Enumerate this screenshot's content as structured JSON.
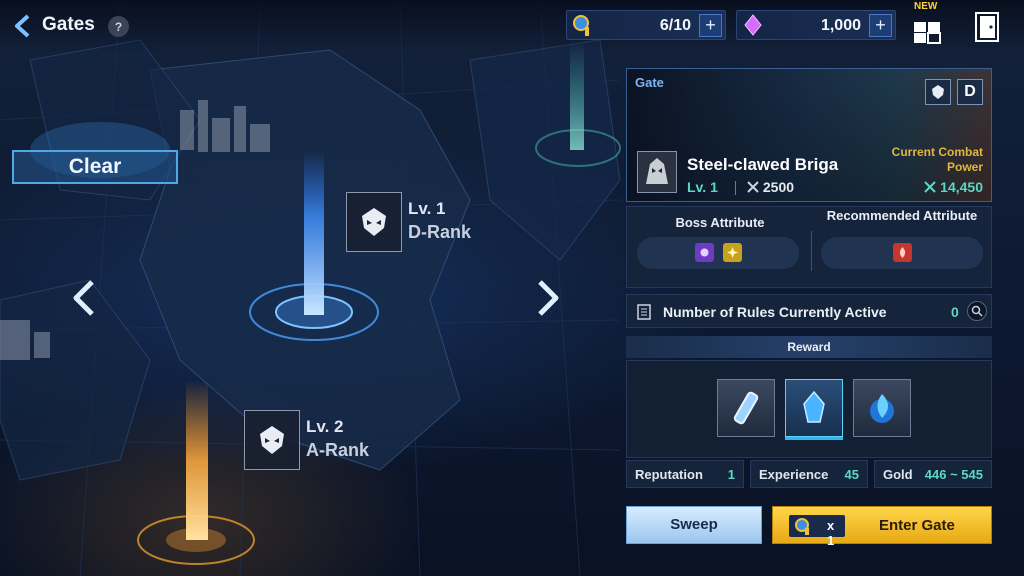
{
  "header": {
    "title": "Gates",
    "help": "?",
    "new_tag": "NEW"
  },
  "resources": {
    "keys": {
      "value": "6/10",
      "icon": "gate-key-icon"
    },
    "crystals": {
      "value": "1,000",
      "icon": "crystal-icon"
    },
    "plus": "+"
  },
  "map": {
    "clear_label": "Clear",
    "gates": [
      {
        "level": "Lv. 1",
        "rank": "D-Rank",
        "beam_color": "#2f7dff"
      },
      {
        "level": "Lv. 2",
        "rank": "A-Rank",
        "beam_color": "#ff9a2a"
      }
    ]
  },
  "gate_card": {
    "section_label": "Gate",
    "rank_letter": "D",
    "boss_name": "Steel-clawed Briga",
    "boss_level": "Lv. 1",
    "boss_power": "2500",
    "ccp_label": "Current Combat Power",
    "ccp_value": "14,450"
  },
  "attributes": {
    "boss_label": "Boss Attribute",
    "recommended_label": "Recommended Attribute",
    "boss_icons": [
      "dark-attribute-icon",
      "light-attribute-icon"
    ],
    "recommended_icons": [
      "fire-attribute-icon"
    ]
  },
  "rules": {
    "label": "Number of Rules Currently Active",
    "count": "0"
  },
  "reward": {
    "title": "Reward",
    "items": [
      "essence-vial-icon",
      "blue-crystal-icon",
      "blue-flame-orb-icon"
    ]
  },
  "stats": [
    {
      "label": "Reputation",
      "value": "1"
    },
    {
      "label": "Experience",
      "value": "45"
    },
    {
      "label": "Gold",
      "value": "446 ~ 545"
    }
  ],
  "buttons": {
    "sweep": "Sweep",
    "ticket_count": "x 1",
    "enter": "Enter Gate"
  },
  "colors": {
    "accent_teal": "#5cd7c2",
    "accent_gold": "#e3b640",
    "enter_button": "#ffd54a"
  }
}
